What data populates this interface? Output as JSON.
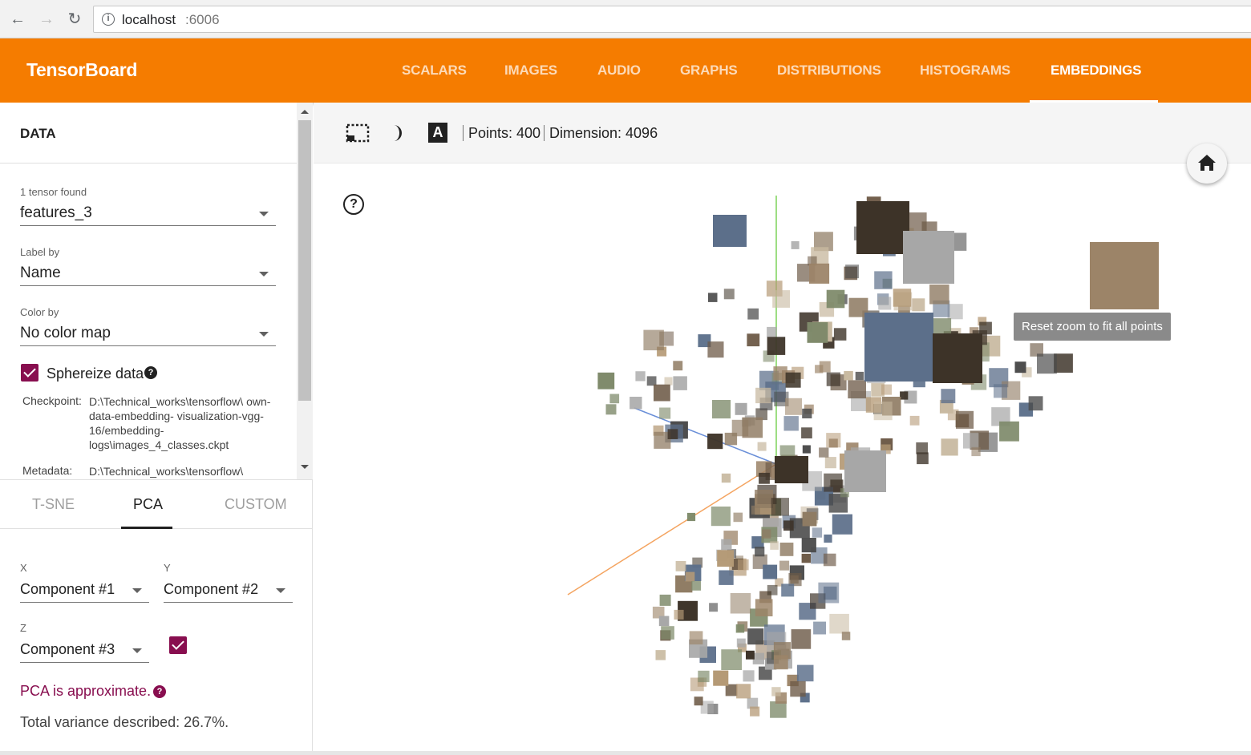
{
  "browser": {
    "url_host": "localhost",
    "url_port": ":6006"
  },
  "header": {
    "title": "TensorBoard",
    "tabs": [
      "SCALARS",
      "IMAGES",
      "AUDIO",
      "GRAPHS",
      "DISTRIBUTIONS",
      "HISTOGRAMS",
      "EMBEDDINGS"
    ],
    "active_tab": "EMBEDDINGS",
    "brand_color": "#f57c00"
  },
  "data_panel": {
    "heading": "DATA",
    "tensor_label": "1 tensor found",
    "tensor_value": "features_3",
    "label_by_label": "Label by",
    "label_by_value": "Name",
    "color_by_label": "Color by",
    "color_by_value": "No color map",
    "sphereize_label": "Sphereize data",
    "sphereize_checked": true,
    "checkpoint_key": "Checkpoint:",
    "checkpoint_value": "D:\\Technical_works\\tensorflow\\ own-data-embedding- visualization-vgg-16/embedding- logs\\images_4_classes.ckpt",
    "metadata_key": "Metadata:",
    "metadata_value": "D:\\Technical_works\\tensorflow\\"
  },
  "projection": {
    "tabs": [
      "T-SNE",
      "PCA",
      "CUSTOM"
    ],
    "active_tab": "PCA",
    "x_label": "X",
    "x_value": "Component #1",
    "y_label": "Y",
    "y_value": "Component #2",
    "z_label": "Z",
    "z_value": "Component #3",
    "z_checked": true,
    "approx_text": "PCA is approximate.",
    "variance_text": "Total variance described: 26.7%."
  },
  "toolbar": {
    "points_text": "Points: 400",
    "dimension_text": "Dimension: 4096",
    "label_icon_letter": "A"
  },
  "canvas": {
    "help_glyph": "?",
    "tooltip_text": "Reset zoom to fit all points",
    "point_count": 400
  },
  "icons": [
    "back-icon",
    "forward-icon",
    "reload-icon",
    "info-icon",
    "selection-icon",
    "night-mode-icon",
    "label-icon",
    "help-icon",
    "home-icon"
  ]
}
